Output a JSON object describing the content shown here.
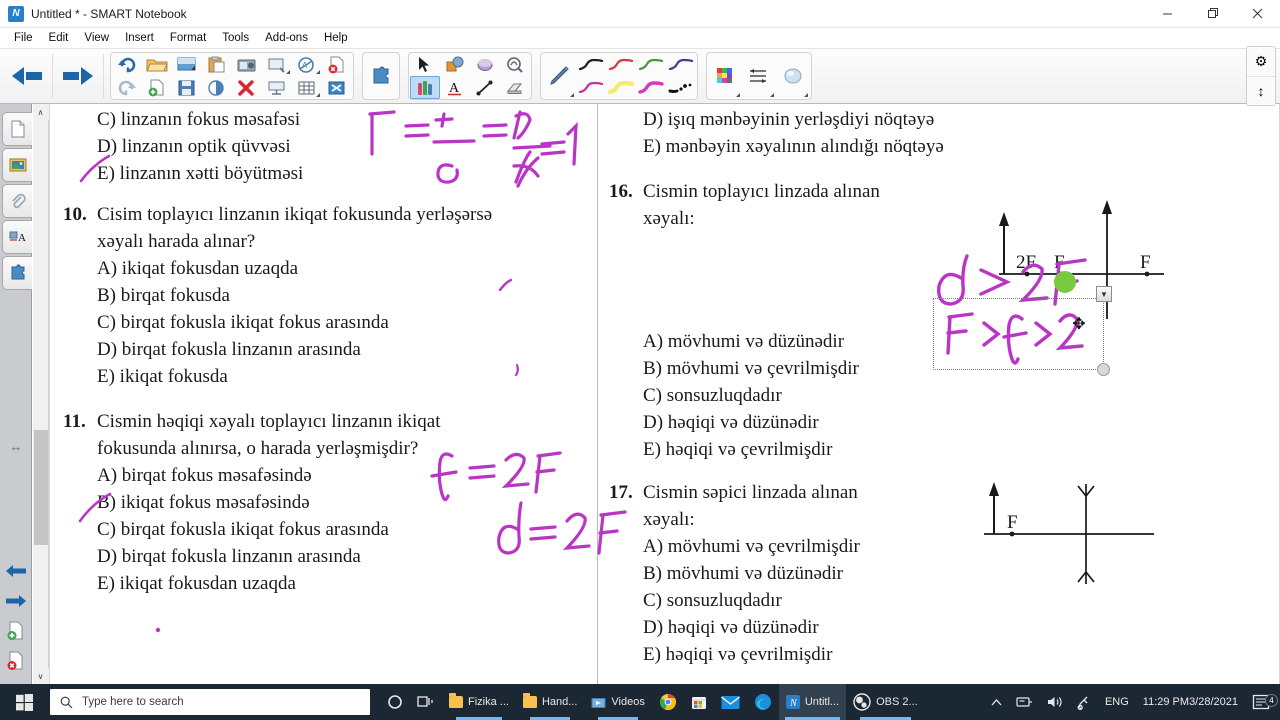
{
  "window": {
    "title": "Untitled * - SMART Notebook",
    "app_icon": "smart-notebook-icon",
    "minimize": "–",
    "maximize": "❐",
    "close": "✕"
  },
  "menu": {
    "items": [
      "File",
      "Edit",
      "View",
      "Insert",
      "Format",
      "Tools",
      "Add-ons",
      "Help"
    ]
  },
  "toolbar": {
    "nav": [
      {
        "name": "previous-page-button",
        "icon": "arrow-left-icon"
      },
      {
        "name": "next-page-button",
        "icon": "arrow-right-icon"
      }
    ],
    "file_row_top": [
      {
        "name": "undo-button",
        "icon": "undo-icon"
      },
      {
        "name": "redo-button",
        "icon": "redo-icon"
      },
      {
        "name": "open-file-button",
        "icon": "open-folder-icon"
      },
      {
        "name": "screen-shade-button",
        "icon": "screen-shade-icon"
      },
      {
        "name": "paste-button",
        "icon": "paste-icon"
      },
      {
        "name": "screen-capture-button",
        "icon": "camera-icon"
      },
      {
        "name": "insert-table-object-button",
        "icon": "insert-object-icon"
      },
      {
        "name": "measurement-tools-button",
        "icon": "measurement-icon"
      }
    ],
    "file_row_bottom": [
      {
        "name": "add-page-button",
        "icon": "add-page-icon"
      },
      {
        "name": "delete-page-button",
        "icon": "delete-page-icon"
      },
      {
        "name": "save-button",
        "icon": "save-disk-icon"
      },
      {
        "name": "transparency-button",
        "icon": "transparency-icon"
      },
      {
        "name": "delete-button",
        "icon": "red-x-icon"
      },
      {
        "name": "full-screen-button",
        "icon": "full-screen-icon"
      },
      {
        "name": "table-button",
        "icon": "table-icon"
      },
      {
        "name": "shape-tools-button",
        "icon": "shape-tools-icon"
      }
    ],
    "addons": [
      {
        "name": "add-ons-button",
        "icon": "puzzle-piece-icon"
      }
    ],
    "tools_row_top": [
      {
        "name": "select-tool",
        "icon": "cursor-arrow-icon"
      },
      {
        "name": "shapes-tool",
        "icon": "shapes-icon"
      },
      {
        "name": "shape-pen-tool",
        "icon": "shape-pen-icon"
      },
      {
        "name": "magic-pen-tool",
        "icon": "magic-pen-icon"
      }
    ],
    "tools_row_bottom": [
      {
        "name": "pens-tool",
        "icon": "pens-icon",
        "selected": true
      },
      {
        "name": "text-tool",
        "icon": "text-a-icon"
      },
      {
        "name": "lines-tool",
        "icon": "line-icon"
      },
      {
        "name": "eraser-tool",
        "icon": "eraser-icon"
      }
    ],
    "pen_styles_top": [
      {
        "name": "pen-style-black",
        "color": "#222222"
      },
      {
        "name": "pen-style-red",
        "color": "#d0394a"
      },
      {
        "name": "pen-style-green",
        "color": "#4a9a3c"
      },
      {
        "name": "pen-style-blue",
        "color": "#3b3fa0"
      }
    ],
    "pen_styles_bottom": [
      {
        "name": "pen-style-magenta",
        "color": "#c0369f"
      },
      {
        "name": "pen-style-highlighter-yellow",
        "color": "#f5ee6a"
      },
      {
        "name": "pen-style-magenta-2",
        "color": "#d23bbe"
      },
      {
        "name": "pen-style-calligraphy",
        "color": "#111111"
      }
    ],
    "extras": [
      {
        "name": "color-palette-button",
        "icon": "color-grid-icon"
      },
      {
        "name": "line-properties-button",
        "icon": "line-properties-icon"
      },
      {
        "name": "fill-properties-button",
        "icon": "fill-icon"
      }
    ],
    "right_controls": [
      {
        "name": "settings-button",
        "icon": "gear-icon",
        "glyph": "⚙"
      },
      {
        "name": "move-toolbar-button",
        "icon": "move-vertical-icon",
        "glyph": "↕"
      }
    ]
  },
  "sidestrip": {
    "tabs": [
      {
        "name": "page-sorter-tab",
        "icon": "page-icon"
      },
      {
        "name": "gallery-tab",
        "icon": "gallery-picture-icon"
      },
      {
        "name": "attachments-tab",
        "icon": "paperclip-icon"
      },
      {
        "name": "properties-tab",
        "icon": "properties-a-icon"
      },
      {
        "name": "addons-tab",
        "icon": "puzzle-piece-icon"
      }
    ],
    "resize_handle": {
      "name": "panel-resize-handle",
      "icon": "resize-horizontal-icon",
      "glyph": "↔"
    },
    "bottom": [
      {
        "name": "previous-page-arrow",
        "icon": "arrow-left-icon"
      },
      {
        "name": "next-page-arrow",
        "icon": "arrow-right-icon"
      },
      {
        "name": "add-page-icon-button",
        "icon": "add-page-icon"
      },
      {
        "name": "delete-page-icon-button",
        "icon": "delete-page-icon"
      }
    ]
  },
  "scrollbar": {
    "up": "∧",
    "down": "∨"
  },
  "document": {
    "left_column": {
      "orphan_options": [
        "C) linzanın fokus məsafəsi",
        "D) linzanın optik qüvvəsi",
        "E) linzanın xətti böyütməsi"
      ],
      "questions": [
        {
          "number": "10.",
          "text_lines": [
            "Cisim toplayıcı linzanın ikiqat fokusunda yerləşərsə",
            "xəyalı harada alınar?"
          ],
          "options": [
            "A) ikiqat fokusdan uzaqda",
            "B) birqat fokusda",
            "C) birqat fokusla ikiqat fokus arasında",
            "D) birqat fokusla linzanın arasında",
            "E) ikiqat fokusda"
          ]
        },
        {
          "number": "11.",
          "text_lines": [
            "Cismin həqiqi xəyalı toplayıcı linzanın ikiqat",
            "fokusunda alınırsa, o harada yerləşmişdir?"
          ],
          "options": [
            "A) birqat fokus məsafəsində",
            "B) ikiqat fokus məsafəsində",
            "C) birqat fokusla ikiqat fokus arasında",
            "D) birqat fokusla linzanın arasında",
            "E) ikiqat fokusdan uzaqda"
          ]
        }
      ]
    },
    "right_column": {
      "orphan_options": [
        "D) işıq mənbəyinin yerləşdiyi nöqtəyə",
        "E) mənbəyin xəyalının alındığı nöqtəyə"
      ],
      "questions": [
        {
          "number": "16.",
          "text_lines": [
            "Cismin toplayıcı linzada alınan",
            "xəyalı:"
          ],
          "options": [
            "A) mövhumi və düzünədir",
            "B) mövhumi və çevrilmişdir",
            "C) sonsuzluqdadır",
            "D) həqiqi və düzünədir",
            "E) həqiqi və çevrilmişdir"
          ],
          "diagram": {
            "name": "converging-lens-diagram",
            "labels": [
              "2F",
              "F",
              "F"
            ]
          }
        },
        {
          "number": "17.",
          "text_lines": [
            "Cismin səpici linzada alınan",
            "xəyalı:"
          ],
          "options": [
            "A) mövhumi və çevrilmişdir",
            "B) mövhumi və düzünədir",
            "C) sonsuzluqdadır",
            "D) həqiqi və düzünədir",
            "E) həqiqi və çevrilmişdir"
          ],
          "diagram": {
            "name": "diverging-lens-diagram",
            "labels": [
              "F"
            ]
          }
        }
      ]
    },
    "ink_annotations": [
      {
        "name": "ink-formula-magnification",
        "text": "Γ = 1/d = H/h = 1",
        "color": "#b935c6"
      },
      {
        "name": "ink-formula-f-equals-2F",
        "text": "ℓ = 2F",
        "color": "#b935c6"
      },
      {
        "name": "ink-formula-d-equals-2F",
        "text": "d = 2F",
        "color": "#b935c6"
      },
      {
        "name": "ink-formula-d-greater-2F",
        "text": "d > 2F",
        "color": "#b935c6"
      },
      {
        "name": "ink-formula-F-less-l-less-2F",
        "text": "F < ℓ < 2F",
        "color": "#b935c6"
      },
      {
        "name": "ink-strike-option-e",
        "text": "",
        "color": "#b935c6"
      },
      {
        "name": "ink-strike-option-b",
        "text": "",
        "color": "#b935c6"
      }
    ],
    "selection": {
      "name": "selected-ink-object",
      "rotate_glyph": "▼",
      "move_glyph": "✥"
    }
  },
  "taskbar": {
    "start": {
      "name": "start-button",
      "icon": "windows-logo-icon"
    },
    "search": {
      "name": "search-input",
      "placeholder": "Type here to search",
      "icon": "search-icon"
    },
    "cortana": {
      "name": "cortana-button",
      "icon": "cortana-circle-icon",
      "glyph": "○"
    },
    "taskview": {
      "name": "task-view-button",
      "icon": "task-view-icon"
    },
    "buttons": [
      {
        "name": "taskbar-item-fizika",
        "label": "Fizika ...",
        "icon": "folder-icon",
        "running": true
      },
      {
        "name": "taskbar-item-hand",
        "label": "Hand...",
        "icon": "folder-icon",
        "running": true
      },
      {
        "name": "taskbar-item-videos",
        "label": "Videos",
        "icon": "videos-folder-icon",
        "running": true
      },
      {
        "name": "taskbar-item-chrome",
        "label": "",
        "icon": "chrome-icon",
        "running": false
      },
      {
        "name": "taskbar-item-store",
        "label": "",
        "icon": "microsoft-store-icon",
        "running": false
      },
      {
        "name": "taskbar-item-mail",
        "label": "",
        "icon": "mail-icon",
        "running": false
      },
      {
        "name": "taskbar-item-edge",
        "label": "",
        "icon": "edge-icon",
        "running": false
      },
      {
        "name": "taskbar-item-smart-notebook",
        "label": "Untitl...",
        "icon": "smart-notebook-icon",
        "active": true
      },
      {
        "name": "taskbar-item-obs",
        "label": "OBS 2...",
        "icon": "obs-icon",
        "running": true
      }
    ],
    "tray": {
      "show_hidden": {
        "name": "show-hidden-icons-button",
        "glyph": "∧"
      },
      "items": [
        {
          "name": "tray-icon-network",
          "glyph": "⌨"
        },
        {
          "name": "tray-icon-volume",
          "glyph": "🔊"
        },
        {
          "name": "tray-icon-bluetooth-or-pen",
          "glyph": "✂"
        }
      ],
      "language": "ENG",
      "time": "11:29 PM",
      "date": "3/28/2021",
      "notifications": {
        "name": "notifications-button",
        "count": "4"
      }
    }
  },
  "colors": {
    "ink": "#b935c6",
    "accent_blue": "#1d64a8",
    "taskbar_bg": "#1b2733",
    "selection_blue": "#6eb9f7",
    "green_dot": "#7ac943"
  }
}
